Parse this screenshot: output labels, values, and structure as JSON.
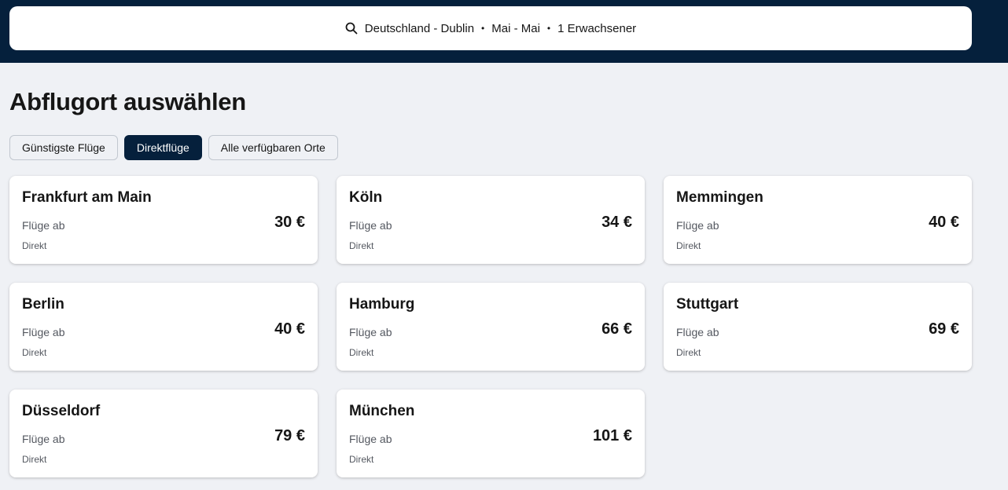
{
  "search": {
    "route": "Deutschland - Dublin",
    "dates": "Mai - Mai",
    "travelers": "1 Erwachsener",
    "separator": "•"
  },
  "page_title": "Abflugort auswählen",
  "filters": [
    {
      "label": "Günstigste Flüge",
      "active": false
    },
    {
      "label": "Direktflüge",
      "active": true
    },
    {
      "label": "Alle verfügbaren Orte",
      "active": false
    }
  ],
  "results": [
    {
      "city": "Frankfurt am Main",
      "from_label": "Flüge ab",
      "price": "30 €",
      "type": "Direkt"
    },
    {
      "city": "Köln",
      "from_label": "Flüge ab",
      "price": "34 €",
      "type": "Direkt"
    },
    {
      "city": "Memmingen",
      "from_label": "Flüge ab",
      "price": "40 €",
      "type": "Direkt"
    },
    {
      "city": "Berlin",
      "from_label": "Flüge ab",
      "price": "40 €",
      "type": "Direkt"
    },
    {
      "city": "Hamburg",
      "from_label": "Flüge ab",
      "price": "66 €",
      "type": "Direkt"
    },
    {
      "city": "Stuttgart",
      "from_label": "Flüge ab",
      "price": "69 €",
      "type": "Direkt"
    },
    {
      "city": "Düsseldorf",
      "from_label": "Flüge ab",
      "price": "79 €",
      "type": "Direkt"
    },
    {
      "city": "München",
      "from_label": "Flüge ab",
      "price": "101 €",
      "type": "Direkt"
    }
  ],
  "colors": {
    "header_bg": "#05203c",
    "page_bg": "#eff1f5",
    "active_chip": "#05203c",
    "card_bg": "#ffffff"
  },
  "icons": {
    "search": "search-icon"
  }
}
